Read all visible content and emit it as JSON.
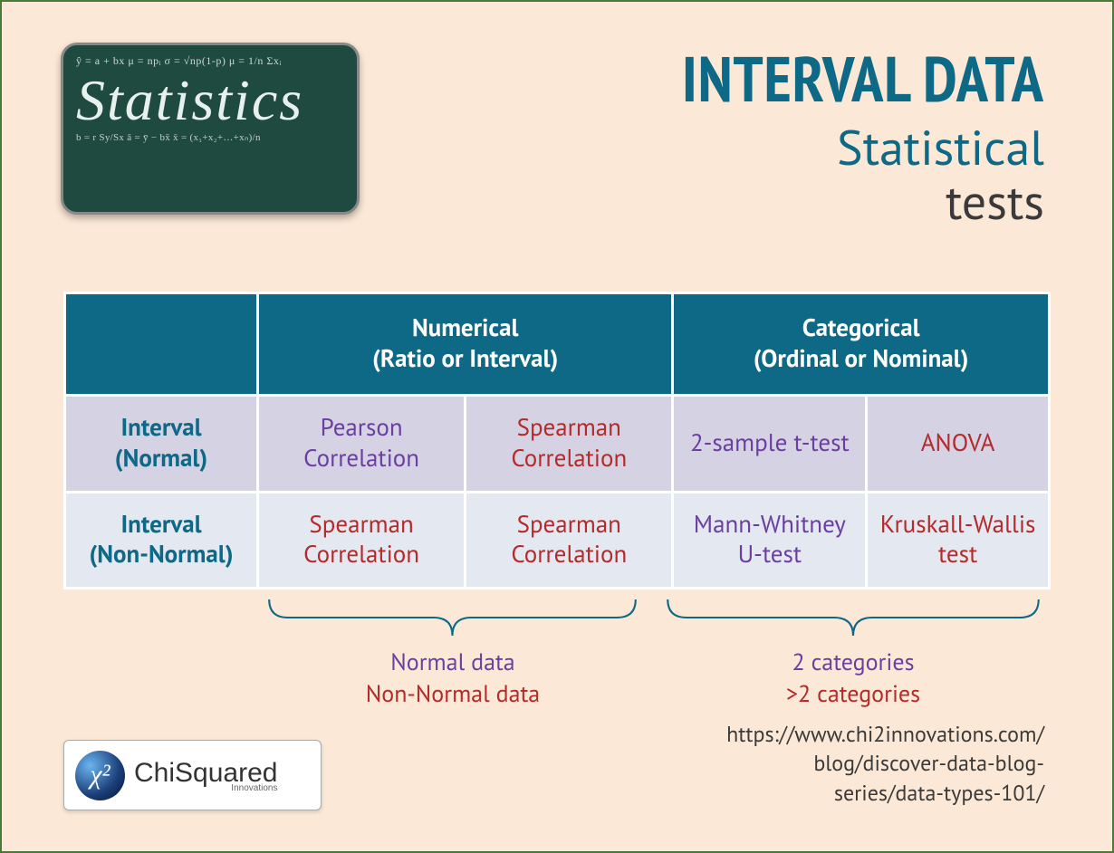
{
  "badge": {
    "formula_top": "ŷ = a + bx  μ = npᵢ  σ = √np(1-p)  μ = 1/n Σxᵢ",
    "big_text": "Statistics",
    "formula_bot": "b = r Sy/Sx  ā = ȳ − bx̄  x̄ = (x₁+x₂+…+xₙ)/n"
  },
  "title": {
    "main": "INTERVAL DATA",
    "sub1": "Statistical",
    "sub2": "tests"
  },
  "table": {
    "headers": {
      "numerical_line1": "Numerical",
      "numerical_line2": "(Ratio or Interval)",
      "categorical_line1": "Categorical",
      "categorical_line2": "(Ordinal or Nominal)"
    },
    "rows": [
      {
        "label_line1": "Interval",
        "label_line2": "(Normal)",
        "cells": [
          {
            "text": "Pearson Correlation",
            "color": "purple"
          },
          {
            "text": "Spearman Correlation",
            "color": "red"
          },
          {
            "text": "2-sample t-test",
            "color": "purple"
          },
          {
            "text": "ANOVA",
            "color": "red"
          }
        ]
      },
      {
        "label_line1": "Interval",
        "label_line2": "(Non-Normal)",
        "cells": [
          {
            "text": "Spearman Correlation",
            "color": "red"
          },
          {
            "text": "Spearman Correlation",
            "color": "red"
          },
          {
            "text": "Mann-Whitney U-test",
            "color": "purple"
          },
          {
            "text": "Kruskall-Wallis test",
            "color": "red"
          }
        ]
      }
    ]
  },
  "legend": {
    "left_line1": "Normal data",
    "left_line2": "Non-Normal data",
    "right_line1": "2 categories",
    "right_line2": ">2 categories"
  },
  "logo": {
    "chi_symbol": "χ²",
    "brand1": "Chi",
    "brand2": "Squared",
    "sub": "Innovations"
  },
  "url": {
    "line1": "https://www.chi2innovations.com/",
    "line2": "blog/discover-data-blog-",
    "line3": "series/data-types-101/"
  }
}
